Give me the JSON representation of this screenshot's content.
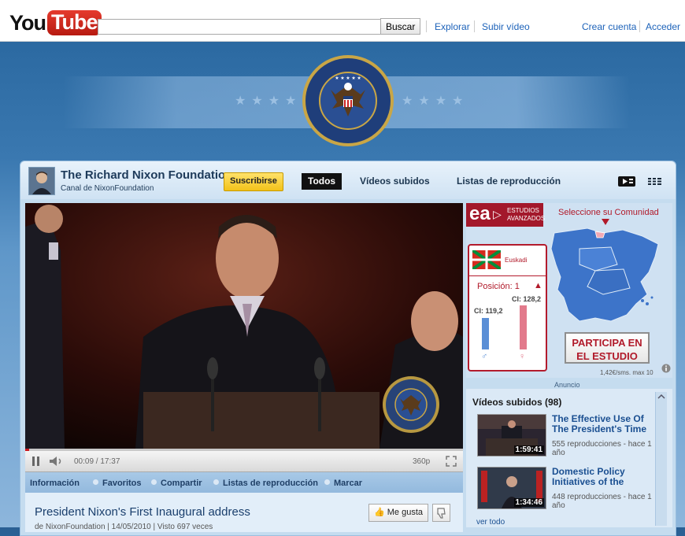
{
  "header": {
    "logo_you": "You",
    "logo_tube": "Tube",
    "search": {
      "value": "",
      "button_label": "Buscar"
    },
    "nav": {
      "explore": "Explorar",
      "upload": "Subir vídeo",
      "create_account": "Crear cuenta",
      "sign_in": "Acceder"
    }
  },
  "channel": {
    "title": "The Richard Nixon Foundation",
    "subtitle": "Canal de NixonFoundation",
    "subscribe_label": "Suscribirse",
    "tabs": [
      "Todos",
      "Vídeos subidos",
      "Listas de reproducción"
    ],
    "active_tab": "Todos"
  },
  "video": {
    "time": "00:09 / 17:37",
    "quality": "360p",
    "progress": 0.009,
    "info_tabs": [
      "Información",
      "Favoritos",
      "Compartir",
      "Listas de reproducción",
      "Marcar"
    ],
    "title": "President Nixon's First Inaugural address",
    "meta": "de NixonFoundation | 14/05/2010 | Visto 697 veces",
    "like_label": "Me gusta"
  },
  "ad": {
    "logo_short": "ea",
    "logo_line1": "ESTUDIOS",
    "logo_line2": "AVANZADOS",
    "community_prompt": "Seleccione su Comunidad",
    "region": "Euskadi",
    "position_label": "Posición: 1",
    "ci_left": "CI: 119,2",
    "ci_right": "CI: 128,2",
    "cta_line1": "PARTICIPA EN",
    "cta_line2": "EL ESTUDIO",
    "price": "1,42€/sms. max 10",
    "label": "Anuncio",
    "accent_color": "#a3182b"
  },
  "uploads": {
    "title": "Vídeos subidos (98)",
    "items": [
      {
        "title": "The Effective Use Of The President's Time",
        "duration": "1:59:41",
        "stats": "555 reproducciones - hace 1 año"
      },
      {
        "title": "Domestic Policy Initiatives of the",
        "duration": "1:34:46",
        "stats": "448 reproducciones - hace 1 año"
      }
    ],
    "see_all": "ver todo"
  }
}
